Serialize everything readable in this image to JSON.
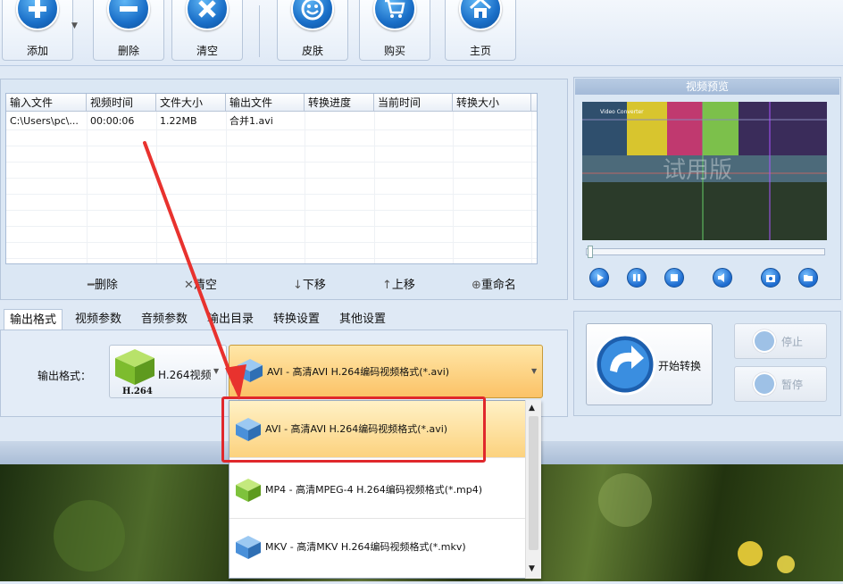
{
  "toolbar": {
    "buttons": [
      {
        "label": "添加",
        "icon": "plus-icon"
      },
      {
        "label": "删除",
        "icon": "minus-icon"
      },
      {
        "label": "清空",
        "icon": "x-icon"
      },
      {
        "label": "皮肤",
        "icon": "smiley-icon"
      },
      {
        "label": "购买",
        "icon": "cart-icon"
      },
      {
        "label": "主页",
        "icon": "home-icon"
      }
    ]
  },
  "filelist": {
    "columns": [
      "输入文件",
      "视频时间",
      "文件大小",
      "输出文件",
      "转换进度",
      "当前时间",
      "转换大小"
    ],
    "rows": [
      [
        "C:\\Users\\pc\\...",
        "00:00:06",
        "1.22MB",
        "合并1.avi",
        "",
        "",
        ""
      ]
    ],
    "actions": {
      "delete": "删除",
      "clear": "清空",
      "down": "下移",
      "up": "上移",
      "rename": "重命名"
    }
  },
  "preview": {
    "title": "视频预览",
    "video_caption": "Video Converter",
    "watermark": "试用版"
  },
  "tabs": [
    "输出格式",
    "视频参数",
    "音频参数",
    "输出目录",
    "转换设置",
    "其他设置"
  ],
  "settings": {
    "format_label": "输出格式：",
    "codec_name": "H.264视频",
    "codec_badge": "H.264",
    "selected_format": "AVI - 高清AVI H.264编码视频格式(*.avi)"
  },
  "convert": {
    "start": "开始转换",
    "stop": "停止",
    "pause": "暂停"
  },
  "dropdown": {
    "options": [
      {
        "label": "AVI - 高清AVI H.264编码视频格式(*.avi)",
        "color": "#4a90d9"
      },
      {
        "label": "MP4 - 高清MPEG-4 H.264编码视频格式(*.mp4)",
        "color": "#7ec23c"
      },
      {
        "label": "MKV - 高清MKV H.264编码视频格式(*.mkv)",
        "color": "#4a90d9"
      }
    ]
  },
  "colors": {
    "highlight": "#e0282c",
    "arrow": "#e8322e",
    "selection": "#fbc266"
  }
}
